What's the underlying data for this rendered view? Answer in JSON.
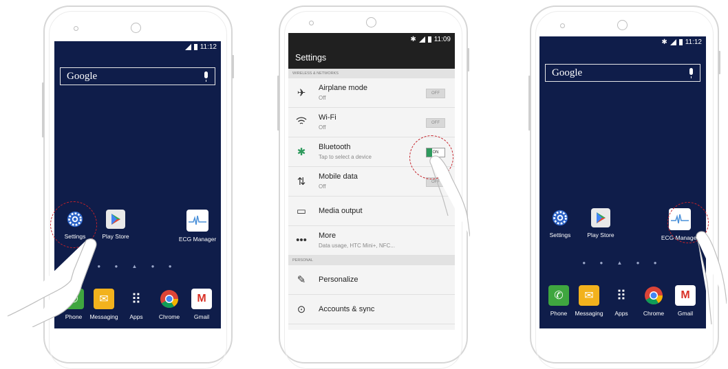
{
  "phone_left": {
    "status_time": "11:12",
    "search_label": "Google",
    "apps": [
      {
        "label": "Settings",
        "icon": "gear-icon"
      },
      {
        "label": "Play Store",
        "icon": "play-store-icon"
      },
      {
        "label": "ECG Manager",
        "icon": "ecg-icon"
      }
    ],
    "dock": [
      {
        "label": "Phone",
        "icon": "phone-icon"
      },
      {
        "label": "Messaging",
        "icon": "envelope-icon"
      },
      {
        "label": "Apps",
        "icon": "grid-icon"
      },
      {
        "label": "Chrome",
        "icon": "chrome-icon"
      },
      {
        "label": "Gmail",
        "icon": "gmail-icon"
      }
    ]
  },
  "phone_mid": {
    "status_time": "11:09",
    "title": "Settings",
    "section_wireless": "WIRELESS & NETWORKS",
    "section_personal": "PERSONAL",
    "rows": [
      {
        "title": "Airplane mode",
        "sub": "Off",
        "toggle": "OFF"
      },
      {
        "title": "Wi-Fi",
        "sub": "Off",
        "toggle": "OFF"
      },
      {
        "title": "Bluetooth",
        "sub": "Tap to select a device",
        "toggle": "ON"
      },
      {
        "title": "Mobile data",
        "sub": "Off",
        "toggle": "OFF"
      },
      {
        "title": "Media output"
      },
      {
        "title": "More",
        "sub": "Data usage, HTC Mini+, NFC..."
      },
      {
        "title": "Personalize"
      },
      {
        "title": "Accounts & sync"
      }
    ]
  },
  "phone_right": {
    "status_time": "11:12",
    "search_label": "Google",
    "apps": [
      {
        "label": "Settings"
      },
      {
        "label": "Play Store"
      },
      {
        "label": "ECG Manager"
      }
    ],
    "dock": [
      {
        "label": "Phone"
      },
      {
        "label": "Messaging"
      },
      {
        "label": "Apps"
      },
      {
        "label": "Chrome"
      },
      {
        "label": "Gmail"
      }
    ]
  },
  "colors": {
    "home_bg": "#0f1d4a",
    "highlight": "#c5222a",
    "toggle_on": "#2e9a5d"
  }
}
